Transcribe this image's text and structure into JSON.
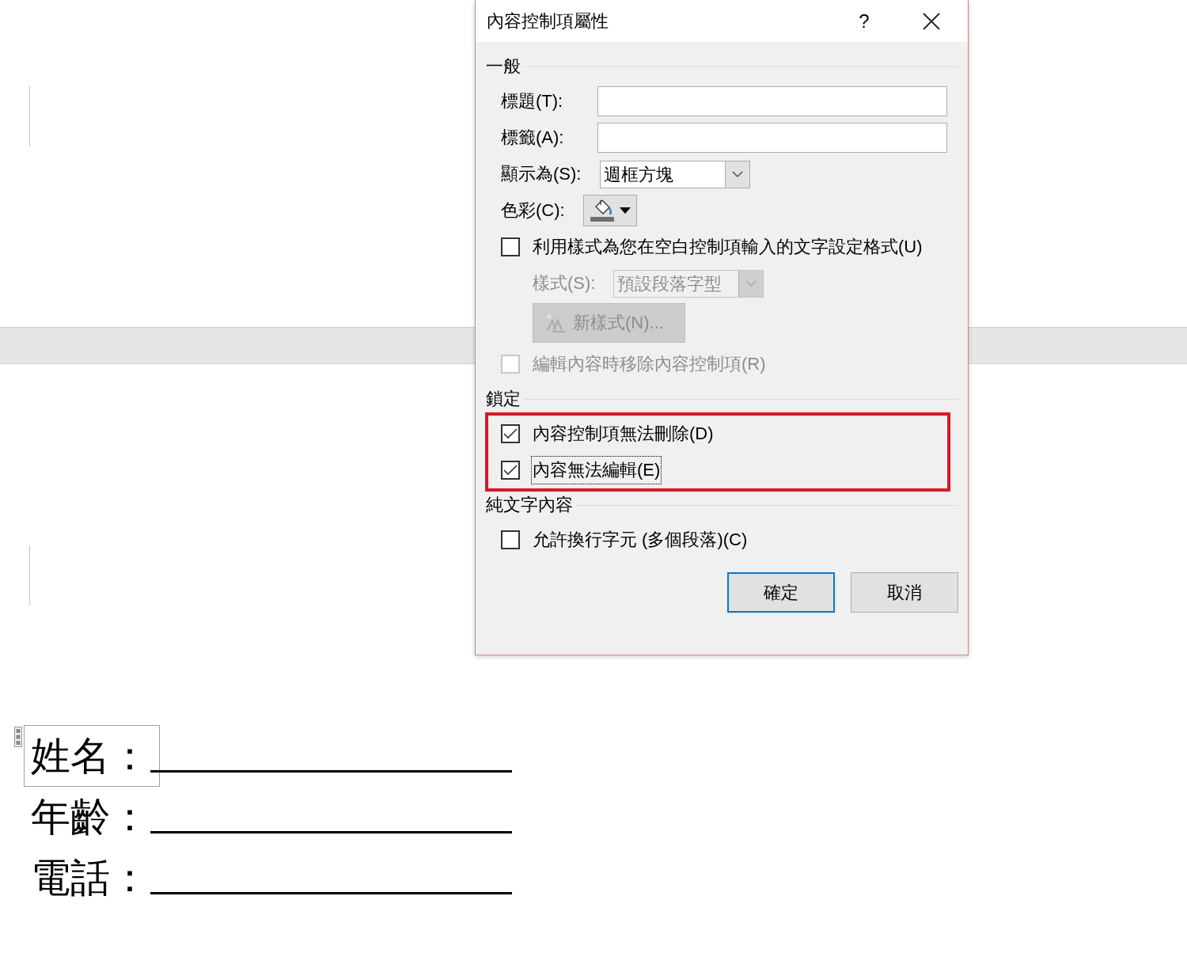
{
  "document": {
    "fields": [
      {
        "label": "姓名：",
        "selected": true
      },
      {
        "label": "年齡：",
        "selected": false
      },
      {
        "label": "電話：",
        "selected": false
      }
    ]
  },
  "dialog": {
    "title": "內容控制項屬性",
    "help": "?",
    "sections": [
      {
        "title": "一般",
        "highlighted": false,
        "items": [
          {
            "kind": "text-field",
            "label": "標題(T):"
          },
          {
            "kind": "text-field",
            "label": "標籤(A):"
          },
          {
            "kind": "dropdown",
            "label": "顯示為(S):",
            "value": "週框方塊",
            "disabled": false
          },
          {
            "kind": "color",
            "label": "色彩(C):"
          },
          {
            "kind": "checkbox",
            "label": "利用樣式為您在空白控制項輸入的文字設定格式(U)",
            "checked": false,
            "disabled": false,
            "focused": false,
            "children": [
              {
                "kind": "dropdown",
                "label": "樣式(S):",
                "value": "預設段落字型",
                "disabled": true
              },
              {
                "kind": "button",
                "label": "新樣式(N)...",
                "disabled": true
              }
            ]
          },
          {
            "kind": "checkbox",
            "label": "編輯內容時移除內容控制項(R)",
            "checked": false,
            "disabled": true,
            "focused": false
          }
        ]
      },
      {
        "title": "鎖定",
        "highlighted": true,
        "items": [
          {
            "kind": "checkbox",
            "label": "內容控制項無法刪除(D)",
            "checked": true,
            "disabled": false,
            "focused": false
          },
          {
            "kind": "checkbox",
            "label": "內容無法編輯(E)",
            "checked": true,
            "disabled": false,
            "focused": true
          }
        ]
      },
      {
        "title": "純文字內容",
        "highlighted": false,
        "items": [
          {
            "kind": "checkbox",
            "label": "允許換行字元 (多個段落)(C)",
            "checked": false,
            "disabled": false,
            "focused": false
          }
        ]
      }
    ],
    "buttons": [
      {
        "label": "確定",
        "default": true
      },
      {
        "label": "取消",
        "default": false
      }
    ]
  }
}
